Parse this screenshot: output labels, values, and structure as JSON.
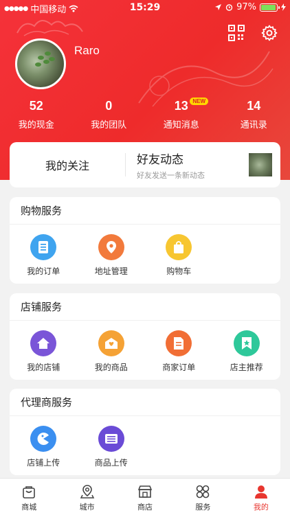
{
  "status_bar": {
    "carrier": "中国移动",
    "time": "15:29",
    "battery": "97%",
    "battery_level": 0.97
  },
  "profile": {
    "username": "Raro"
  },
  "stats": [
    {
      "value": "52",
      "label": "我的现金"
    },
    {
      "value": "0",
      "label": "我的团队"
    },
    {
      "value": "13",
      "label": "通知消息",
      "badge": "NEW"
    },
    {
      "value": "14",
      "label": "通讯录"
    }
  ],
  "follow": {
    "my_follow": "我的关注",
    "friends_title": "好友动态",
    "friends_sub": "好友发送一条新动态"
  },
  "shopping_service": {
    "title": "购物服务",
    "items": [
      {
        "label": "我的订单",
        "icon": "order-list-icon",
        "color": "#3fa4ef"
      },
      {
        "label": "地址管理",
        "icon": "location-pin-icon",
        "color": "#f27a3c"
      },
      {
        "label": "购物车",
        "icon": "shopping-bag-icon",
        "color": "#f7c631"
      }
    ]
  },
  "store_service": {
    "title": "店铺服务",
    "items": [
      {
        "label": "我的店铺",
        "icon": "home-icon",
        "color": "#7a55d8"
      },
      {
        "label": "我的商品",
        "icon": "heart-mail-icon",
        "color": "#f5a235"
      },
      {
        "label": "商家订单",
        "icon": "document-icon",
        "color": "#f16e35"
      },
      {
        "label": "店主推荐",
        "icon": "bookmark-icon",
        "color": "#2ec89a"
      }
    ]
  },
  "agent_service": {
    "title": "代理商服务",
    "items": [
      {
        "label": "店铺上传",
        "icon": "pacman-icon",
        "color": "#3b8ff0"
      },
      {
        "label": "商品上传",
        "icon": "upload-list-icon",
        "color": "#6a4bd6"
      }
    ]
  },
  "tabbar": [
    {
      "label": "商城",
      "icon": "mall-bag-icon"
    },
    {
      "label": "城市",
      "icon": "map-pin-icon"
    },
    {
      "label": "商店",
      "icon": "store-icon"
    },
    {
      "label": "服务",
      "icon": "grid-icon"
    },
    {
      "label": "我的",
      "icon": "user-icon",
      "active": true
    }
  ],
  "colors": {
    "primary": "#ee2b2b",
    "active_tab": "#e8362f"
  }
}
